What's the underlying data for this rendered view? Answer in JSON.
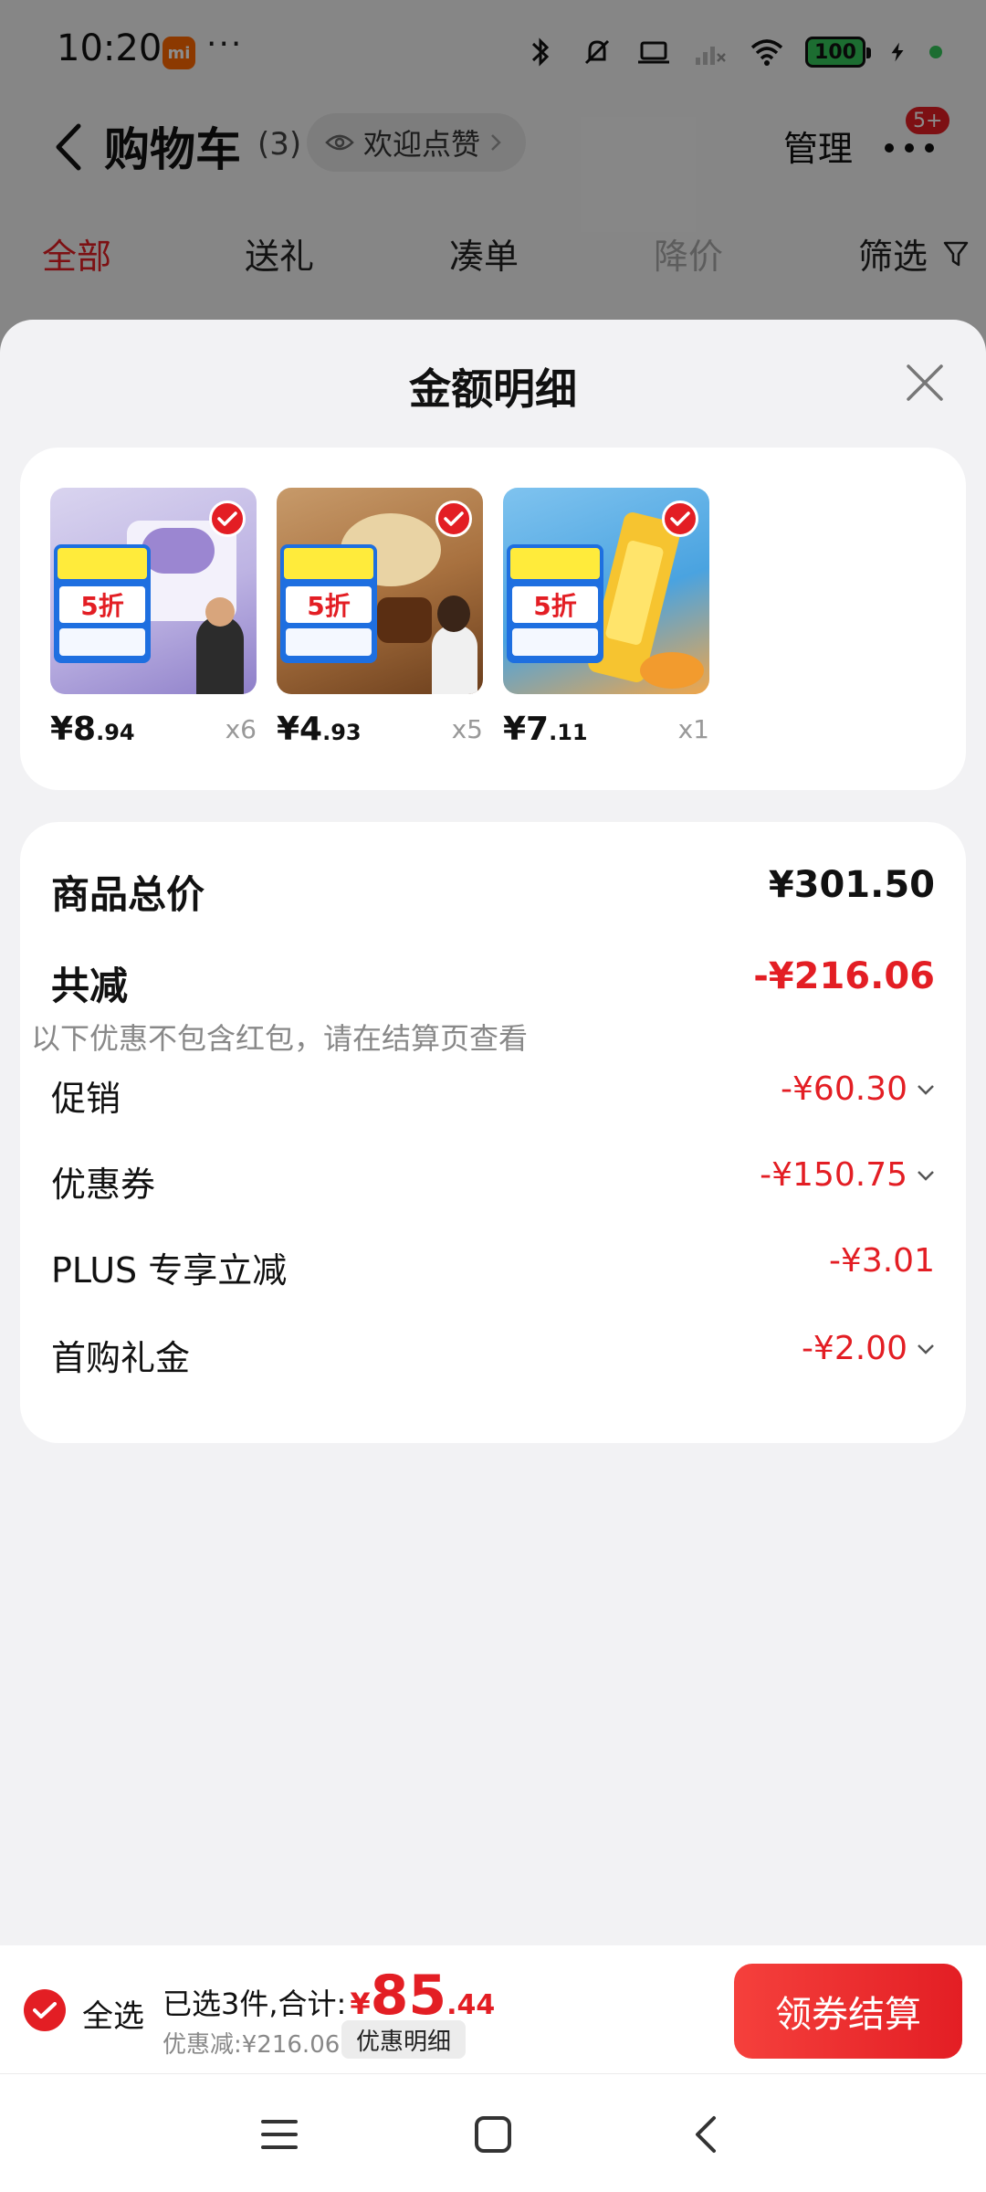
{
  "status_bar": {
    "time": "10:20",
    "mi_label": "mi",
    "more": "···",
    "battery": "100",
    "icons": [
      "bluetooth-icon",
      "mute-icon",
      "laptop-icon",
      "signal-icon",
      "wifi-icon",
      "battery-icon",
      "charging-icon"
    ]
  },
  "nav": {
    "back_icon": "chevron-left-icon",
    "title": "购物车",
    "count": "(3)",
    "fav_label": "欢迎点赞",
    "manage": "管理",
    "badge": "5+"
  },
  "tabs": [
    "全部",
    "送礼",
    "凑单",
    "降价",
    "筛选"
  ],
  "sheet": {
    "title": "金额明细",
    "products": [
      {
        "price_int": "¥8",
        "price_dec": ".94",
        "qty": "x6",
        "badge": "5折"
      },
      {
        "price_int": "¥4",
        "price_dec": ".93",
        "qty": "x5",
        "badge": "5折"
      },
      {
        "price_int": "¥7",
        "price_dec": ".11",
        "qty": "x1",
        "badge": "5折"
      }
    ],
    "details": {
      "total_label": "商品总价",
      "total_value": "¥301.50",
      "reduce_label": "共减",
      "reduce_value": "-¥216.06",
      "note": "以下优惠不包含红包，请在结算页查看",
      "items": [
        {
          "label": "促销",
          "value": "-¥60.30"
        },
        {
          "label": "优惠券",
          "value": "-¥150.75"
        },
        {
          "label": "PLUS 专享立减",
          "value": "-¥3.01"
        },
        {
          "label": "首购礼金",
          "value": "-¥2.00"
        }
      ]
    }
  },
  "checkout": {
    "select_all": "全选",
    "selected_text": "已选3件,合计:",
    "yen": "¥",
    "amount_int": "85",
    "amount_dec": ".44",
    "discount_text": "优惠减:¥216.06",
    "detail_button": "优惠明细",
    "checkout_button": "领券结算"
  },
  "colors": {
    "accent": "#e31e24",
    "battery": "#34c759"
  }
}
